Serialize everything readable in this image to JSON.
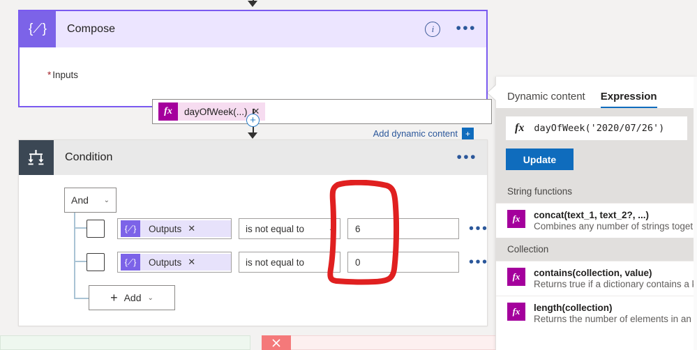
{
  "compose_card": {
    "title": "Compose",
    "icon": "compose-braces-icon",
    "icon_glyph": "{⟋}",
    "accent_color": "#7c63e8",
    "header_bg": "#ece5ff",
    "inputs_label": "Inputs",
    "required_marker": "*",
    "input_token": {
      "fx_glyph": "fx",
      "text": "dayOfWeek(...)",
      "remove_glyph": "✕"
    },
    "add_dynamic_content": "Add dynamic content",
    "add_dynamic_button_glyph": "+",
    "info_glyph": "i",
    "menu_glyph": "•••"
  },
  "condition_card": {
    "title": "Condition",
    "icon": "condition-split-icon",
    "header_bg": "#e9e9e9",
    "icon_bg": "#3b4754",
    "menu_glyph": "•••",
    "logic_operator": "And",
    "chevron_glyph": "⌄",
    "rows": [
      {
        "checkbox_checked": false,
        "token_glyph": "{⟋}",
        "token_label": "Outputs",
        "token_remove": "✕",
        "operator": "is not equal to",
        "value": "6",
        "menu_glyph": "•••"
      },
      {
        "checkbox_checked": false,
        "token_glyph": "{⟋}",
        "token_label": "Outputs",
        "token_remove": "✕",
        "operator": "is not equal to",
        "value": "0",
        "menu_glyph": "•••"
      }
    ],
    "add_button": {
      "plus_glyph": "+",
      "label": "Add",
      "chevron_glyph": "⌄"
    }
  },
  "connectors": {
    "plus_glyph": "+"
  },
  "branches": {
    "yes_color": "#eef7ef",
    "no_color": "#fdf0f0",
    "no_icon_glyph": "✕"
  },
  "annotation": {
    "type": "hand-drawn-rectangle",
    "color": "#e02020",
    "targets": "value fields 6 and 0"
  },
  "flyout": {
    "tabs": [
      {
        "label": "Dynamic content",
        "active": false
      },
      {
        "label": "Expression",
        "active": true
      }
    ],
    "expression_input": {
      "fx_glyph": "fx",
      "value": "dayOfWeek('2020/07/26')"
    },
    "update_label": "Update",
    "sections": [
      {
        "heading": "String functions",
        "items": [
          {
            "icon": "fx",
            "name": "concat(text_1, text_2?, ...)",
            "description": "Combines any number of strings togeth"
          }
        ]
      },
      {
        "heading": "Collection",
        "items": [
          {
            "icon": "fx",
            "name": "contains(collection, value)",
            "description": "Returns true if a dictionary contains a ke"
          },
          {
            "icon": "fx",
            "name": "length(collection)",
            "description": "Returns the number of elements in an a"
          }
        ]
      }
    ]
  }
}
